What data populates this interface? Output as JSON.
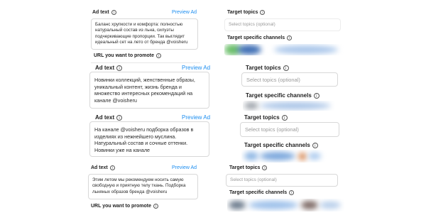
{
  "blocks": [
    {
      "ad_text_label": "Ad text",
      "preview_label": "Preview Ad",
      "ad_text": "Баланс хрупкости и комфорта: полностью натуральный состав из льна, силуэты подчеркивающие пропорции. Так выглядит идеальный сет на лето от бренда @voisheru",
      "url_label": "URL you want to promote",
      "topics_label": "Target topics",
      "topics_placeholder": "Select topics (optional)",
      "channels_label": "Target specific channels"
    },
    {
      "ad_text_label": "Ad text",
      "preview_label": "Preview Ad",
      "ad_text": "Новинки коллекций, женственные образы, уникальный контент, жизнь бренда и множество интересных рекомендаций на канале @voisheru",
      "topics_label": "Target topics",
      "topics_placeholder": "Select topics (optional)",
      "channels_label": "Target specific channels"
    },
    {
      "ad_text_label": "Ad text",
      "preview_label": "Preview Ad",
      "ad_text": "На канале @voisheru подборка образов в изделиях из нежнейшего муслина. Натуральный состав и сочные оттенки. Новинки уже на канале",
      "topics_label": "Target topics",
      "topics_placeholder": "Select topics (optional)",
      "channels_label": "Target specific channels"
    },
    {
      "ad_text_label": "Ad text",
      "preview_label": "Preview Ad",
      "ad_text": "Этим летом мы рекомендуем носить самую свободную и приятную телу ткань. Подборка льняных образов бренда @voisheru",
      "url_label": "URL you want to promote",
      "topics_label": "Target topics",
      "topics_placeholder": "Select topics (optional)",
      "channels_label": "Target specific channels"
    }
  ],
  "icons": {
    "info": "info-circle-icon"
  },
  "colors": {
    "link": "#1d8ef0",
    "border": "#d8d8d8",
    "placeholder": "#9a9a9a"
  }
}
